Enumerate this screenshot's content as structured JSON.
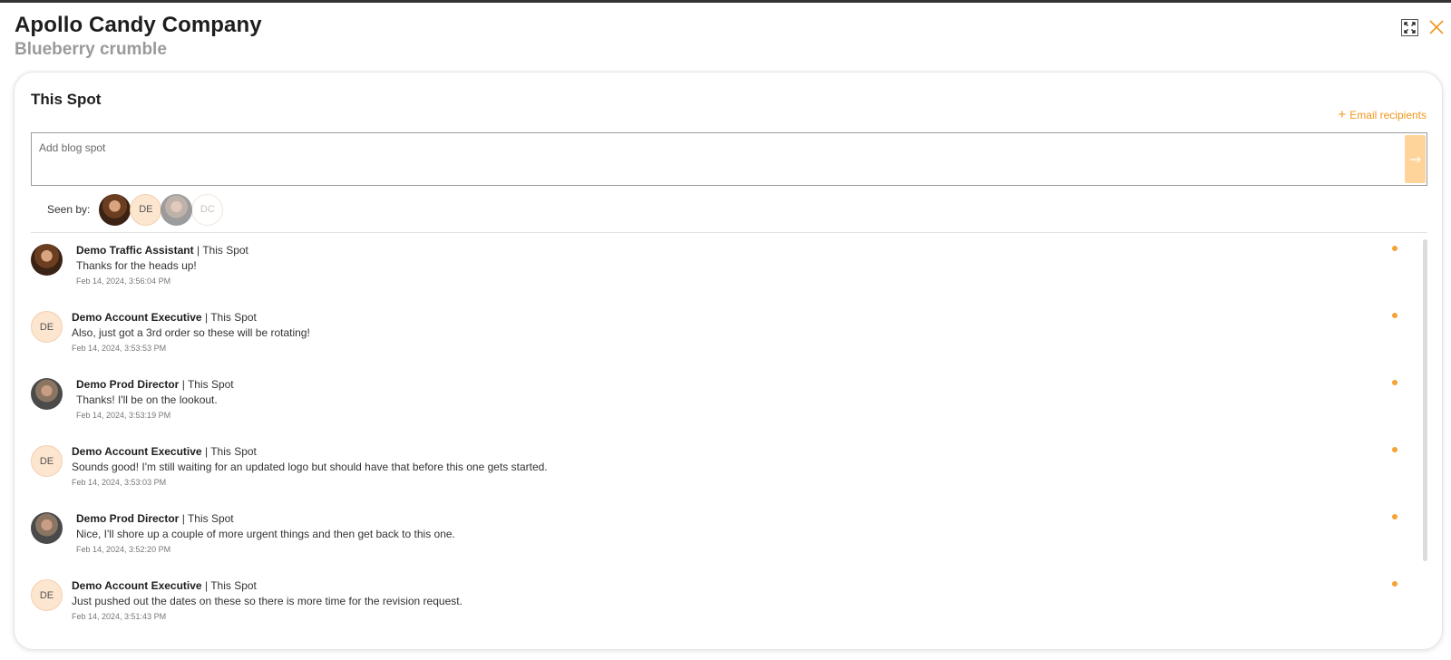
{
  "header": {
    "company": "Apollo Candy Company",
    "subtitle": "Blueberry crumble"
  },
  "panel": {
    "title": "This Spot",
    "email_recipients_label": "Email recipients",
    "compose_placeholder": "Add blog spot",
    "send_icon": "arrow-right",
    "seen_by_label": "Seen by:",
    "seen_by": [
      {
        "type": "photo",
        "name": "Demo Traffic Assistant"
      },
      {
        "type": "initials",
        "initials": "DE"
      },
      {
        "type": "photo",
        "name": "Demo Prod Director"
      },
      {
        "type": "initials",
        "initials": "DC"
      }
    ]
  },
  "messages": [
    {
      "author": "Demo Traffic Assistant",
      "separator": "|",
      "context": "This Spot",
      "text": "Thanks for the heads up!",
      "time": "Feb 14, 2024, 3:56:04 PM",
      "avatar": "photo-a",
      "initials": ""
    },
    {
      "author": "Demo Account Executive",
      "separator": "|",
      "context": "This Spot",
      "text": "Also, just got a 3rd order so these will be rotating!",
      "time": "Feb 14, 2024, 3:53:53 PM",
      "avatar": "initials",
      "initials": "DE"
    },
    {
      "author": "Demo Prod Director",
      "separator": "|",
      "context": "This Spot",
      "text": "Thanks! I'll be on the lookout.",
      "time": "Feb 14, 2024, 3:53:19 PM",
      "avatar": "photo-b",
      "initials": ""
    },
    {
      "author": "Demo Account Executive",
      "separator": "|",
      "context": "This Spot",
      "text": "Sounds good! I'm still waiting for an updated logo but should have that before this one gets started.",
      "time": "Feb 14, 2024, 3:53:03 PM",
      "avatar": "initials",
      "initials": "DE"
    },
    {
      "author": "Demo Prod Director",
      "separator": "|",
      "context": "This Spot",
      "text": "Nice, I'll shore up a couple of more urgent things and then get back to this one.",
      "time": "Feb 14, 2024, 3:52:20 PM",
      "avatar": "photo-b",
      "initials": ""
    },
    {
      "author": "Demo Account Executive",
      "separator": "|",
      "context": "This Spot",
      "text": "Just pushed out the dates on these so there is more time for the revision request.",
      "time": "Feb 14, 2024, 3:51:43 PM",
      "avatar": "initials",
      "initials": "DE"
    }
  ],
  "colors": {
    "accent": "#f0961e",
    "unread_dot": "#f6a234",
    "send_button": "#ffd49a",
    "initials_bg": "#fde6cf"
  }
}
